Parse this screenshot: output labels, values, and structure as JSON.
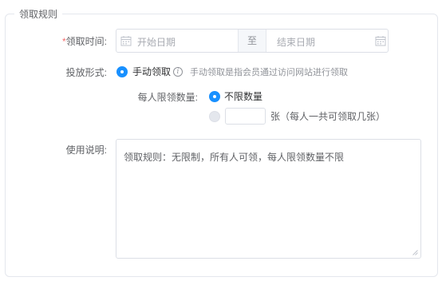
{
  "section": {
    "title": "领取规则"
  },
  "time": {
    "required_mark": "*",
    "label": "领取时间:",
    "start_placeholder": "开始日期",
    "separator": "至",
    "end_placeholder": "结束日期"
  },
  "delivery": {
    "label": "投放形式:",
    "option": "手动领取",
    "hint": "手动领取是指会员通过访问网站进行领取"
  },
  "limit": {
    "label": "每人限领数量:",
    "unlimited": "不限数量",
    "unit_note": "张（每人一共可领取几张）",
    "value": ""
  },
  "usage": {
    "label": "使用说明:",
    "text": "领取规则：无限制，所有人可领，每人限领数量不限"
  },
  "colors": {
    "accent": "#1890ff",
    "required": "#f56c6c"
  },
  "icons": {
    "calendar": "calendar-icon",
    "info": "info-icon",
    "resize": "resize-handle-icon"
  }
}
